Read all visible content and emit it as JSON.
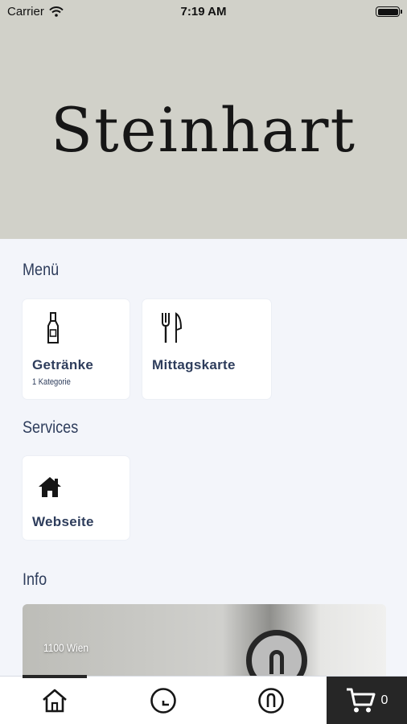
{
  "status_bar": {
    "carrier": "Carrier",
    "time": "7:19 AM"
  },
  "hero": {
    "logo_text": "Steinhart"
  },
  "menu": {
    "title": "Menü",
    "items": [
      {
        "label": "Getränke",
        "subtitle": "1 Kategorie",
        "icon": "bottle-icon"
      },
      {
        "label": "Mittagskarte",
        "subtitle": "",
        "icon": "cutlery-icon"
      }
    ]
  },
  "services": {
    "title": "Services",
    "items": [
      {
        "label": "Webseite",
        "icon": "home-icon"
      }
    ]
  },
  "info": {
    "title": "Info",
    "address": "1100 Wien"
  },
  "tab_bar": {
    "tabs": [
      {
        "icon": "home-icon",
        "active": true
      },
      {
        "icon": "clock-icon",
        "active": false
      },
      {
        "icon": "user-icon",
        "active": false
      }
    ],
    "cart_count": "0"
  },
  "colors": {
    "hero_bg": "#d1d1c9",
    "text": "#2e3d5c",
    "cart_bg": "#262626",
    "page_bg": "#f3f5fa"
  }
}
